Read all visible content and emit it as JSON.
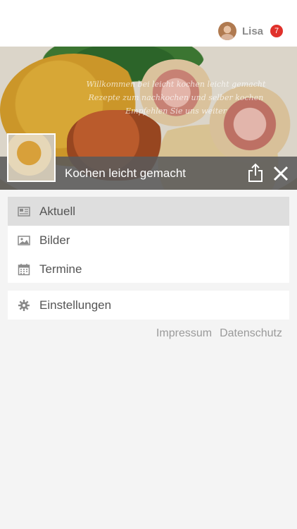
{
  "header": {
    "user_name": "Lisa",
    "notification_count": "7"
  },
  "hero": {
    "tagline_lines": [
      "Willkommen bei leicht kochen leicht gemacht",
      "Rezepte zum nachkochen und selber kochen",
      "Empfehlen Sie uns weiter"
    ],
    "page_title": "Kochen leicht gemacht"
  },
  "menu": {
    "items": [
      {
        "label": "Aktuell",
        "icon": "newspaper-icon",
        "active": true
      },
      {
        "label": "Bilder",
        "icon": "image-icon",
        "active": false
      },
      {
        "label": "Termine",
        "icon": "calendar-icon",
        "active": false
      }
    ],
    "settings": {
      "label": "Einstellungen",
      "icon": "gear-icon"
    }
  },
  "footer": {
    "impressum": "Impressum",
    "datenschutz": "Datenschutz"
  },
  "colors": {
    "badge": "#e0312b",
    "title_bar": "#5a5a5a",
    "active_row": "#dedede"
  }
}
